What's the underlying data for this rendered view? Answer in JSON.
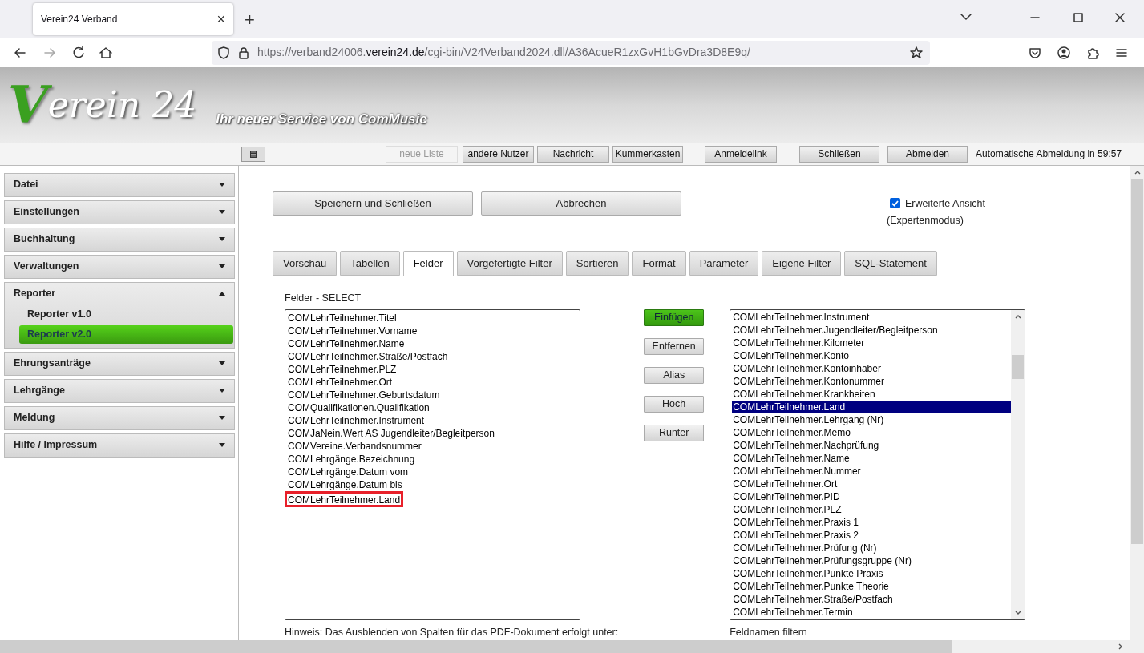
{
  "browser": {
    "tab_title": "Verein24 Verband",
    "url_prefix": "https://verband24006.",
    "url_host": "verein24.de",
    "url_suffix": "/cgi-bin/V24Verband2024.dll/A36AcueR1zxGvH1bGvDra3D8E9q/",
    "tab_close": "×",
    "new_tab": "+"
  },
  "header": {
    "logo_initial": "V",
    "logo_rest": "erein 24",
    "tagline": "Ihr neuer Service von ComMusic"
  },
  "toolbar": {
    "buttons": [
      {
        "label": "neue Liste",
        "disabled": true
      },
      {
        "label": "andere Nutzer",
        "disabled": false
      },
      {
        "label": "Nachricht",
        "disabled": false
      },
      {
        "label": "Kummerkasten",
        "disabled": false
      },
      {
        "label": "Anmeldelink",
        "disabled": false
      },
      {
        "label": "Schließen",
        "disabled": false
      },
      {
        "label": "Abmelden",
        "disabled": false
      }
    ],
    "logout_timer": "Automatische Abmeldung in 59:57"
  },
  "sidebar": {
    "items": [
      {
        "label": "Datei",
        "expanded": false
      },
      {
        "label": "Einstellungen",
        "expanded": false
      },
      {
        "label": "Buchhaltung",
        "expanded": false
      },
      {
        "label": "Verwaltungen",
        "expanded": false
      },
      {
        "label": "Reporter",
        "expanded": true,
        "children": [
          {
            "label": "Reporter v1.0",
            "selected": false
          },
          {
            "label": "Reporter v2.0",
            "selected": true
          }
        ]
      },
      {
        "label": "Ehrungsanträge",
        "expanded": false
      },
      {
        "label": "Lehrgänge",
        "expanded": false
      },
      {
        "label": "Meldung",
        "expanded": false
      },
      {
        "label": "Hilfe / Impressum",
        "expanded": false
      }
    ]
  },
  "actions": [
    "Speichern und Schließen",
    "Abbrechen"
  ],
  "expert_view": {
    "label": "Erweiterte Ansicht",
    "note": "(Expertenmodus)",
    "checked": true
  },
  "tabs": [
    {
      "label": "Vorschau",
      "selected": false
    },
    {
      "label": "Tabellen",
      "selected": false
    },
    {
      "label": "Felder",
      "selected": true
    },
    {
      "label": "Vorgefertigte Filter",
      "selected": false
    },
    {
      "label": "Sortieren",
      "selected": false
    },
    {
      "label": "Format",
      "selected": false
    },
    {
      "label": "Parameter",
      "selected": false
    },
    {
      "label": "Eigene Filter",
      "selected": false
    },
    {
      "label": "SQL-Statement",
      "selected": false
    }
  ],
  "selected_fields": {
    "label": "Felder - SELECT",
    "items": [
      {
        "text": "COMLehrTeilnehmer.Titel",
        "highlighted": false
      },
      {
        "text": "COMLehrTeilnehmer.Vorname",
        "highlighted": false
      },
      {
        "text": "COMLehrTeilnehmer.Name",
        "highlighted": false
      },
      {
        "text": "COMLehrTeilnehmer.Straße/Postfach",
        "highlighted": false
      },
      {
        "text": "COMLehrTeilnehmer.PLZ",
        "highlighted": false
      },
      {
        "text": "COMLehrTeilnehmer.Ort",
        "highlighted": false
      },
      {
        "text": "COMLehrTeilnehmer.Geburtsdatum",
        "highlighted": false
      },
      {
        "text": "COMQualifikationen.Qualifikation",
        "highlighted": false
      },
      {
        "text": "COMLehrTeilnehmer.Instrument",
        "highlighted": false
      },
      {
        "text": "COMJaNein.Wert AS Jugendleiter/Begleitperson",
        "highlighted": false
      },
      {
        "text": "COMVereine.Verbandsnummer",
        "highlighted": false
      },
      {
        "text": "COMLehrgänge.Bezeichnung",
        "highlighted": false
      },
      {
        "text": "COMLehrgänge.Datum vom",
        "highlighted": false
      },
      {
        "text": "COMLehrgänge.Datum bis",
        "highlighted": false
      },
      {
        "text": "COMLehrTeilnehmer.Land",
        "highlighted": true
      }
    ]
  },
  "field_buttons": [
    {
      "label": "Einfügen",
      "primary": true
    },
    {
      "label": "Entfernen",
      "primary": false
    },
    {
      "label": "Alias",
      "primary": false
    },
    {
      "label": "Hoch",
      "primary": false
    },
    {
      "label": "Runter",
      "primary": false
    }
  ],
  "available_fields": {
    "items": [
      {
        "text": "COMLehrTeilnehmer.Instrument",
        "selected": false
      },
      {
        "text": "COMLehrTeilnehmer.Jugendleiter/Begleitperson",
        "selected": false
      },
      {
        "text": "COMLehrTeilnehmer.Kilometer",
        "selected": false
      },
      {
        "text": "COMLehrTeilnehmer.Konto",
        "selected": false
      },
      {
        "text": "COMLehrTeilnehmer.Kontoinhaber",
        "selected": false
      },
      {
        "text": "COMLehrTeilnehmer.Kontonummer",
        "selected": false
      },
      {
        "text": "COMLehrTeilnehmer.Krankheiten",
        "selected": false
      },
      {
        "text": "COMLehrTeilnehmer.Land",
        "selected": true
      },
      {
        "text": "COMLehrTeilnehmer.Lehrgang (Nr)",
        "selected": false
      },
      {
        "text": "COMLehrTeilnehmer.Memo",
        "selected": false
      },
      {
        "text": "COMLehrTeilnehmer.Nachprüfung",
        "selected": false
      },
      {
        "text": "COMLehrTeilnehmer.Name",
        "selected": false
      },
      {
        "text": "COMLehrTeilnehmer.Nummer",
        "selected": false
      },
      {
        "text": "COMLehrTeilnehmer.Ort",
        "selected": false
      },
      {
        "text": "COMLehrTeilnehmer.PID",
        "selected": false
      },
      {
        "text": "COMLehrTeilnehmer.PLZ",
        "selected": false
      },
      {
        "text": "COMLehrTeilnehmer.Praxis 1",
        "selected": false
      },
      {
        "text": "COMLehrTeilnehmer.Praxis 2",
        "selected": false
      },
      {
        "text": "COMLehrTeilnehmer.Prüfung (Nr)",
        "selected": false
      },
      {
        "text": "COMLehrTeilnehmer.Prüfungsgruppe (Nr)",
        "selected": false
      },
      {
        "text": "COMLehrTeilnehmer.Punkte Praxis",
        "selected": false
      },
      {
        "text": "COMLehrTeilnehmer.Punkte Theorie",
        "selected": false
      },
      {
        "text": "COMLehrTeilnehmer.Straße/Postfach",
        "selected": false
      },
      {
        "text": "COMLehrTeilnehmer.Termin",
        "selected": false
      }
    ]
  },
  "hint": "Hinweis: Das Ausblenden von Spalten für das PDF-Dokument erfolgt unter:",
  "filter_label": "Feldnamen filtern"
}
